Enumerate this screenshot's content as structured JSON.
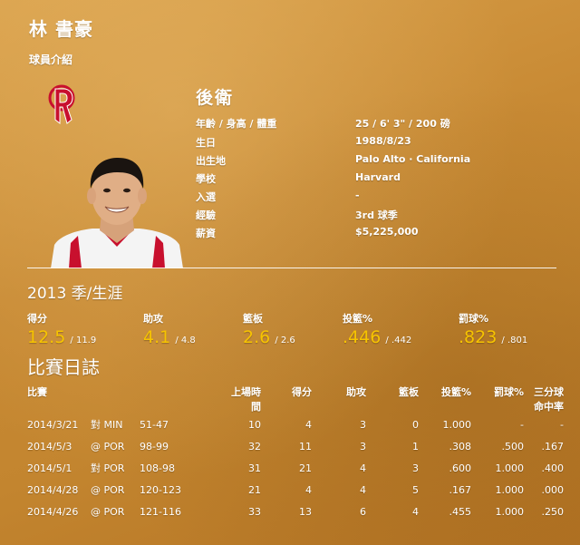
{
  "player": {
    "name": "林 書豪",
    "section_label": "球員介紹",
    "position": "後衛",
    "info": [
      {
        "label": "年齡 / 身高 / 體重",
        "value": "25 / 6' 3\" / 200 磅"
      },
      {
        "label": "生日",
        "value": "1988/8/23"
      },
      {
        "label": "出生地",
        "value": "Palo Alto · California"
      },
      {
        "label": "學校",
        "value": "Harvard"
      },
      {
        "label": "入選",
        "value": "-"
      },
      {
        "label": "經驗",
        "value": "3rd 球季"
      },
      {
        "label": "薪資",
        "value": "$5,225,000"
      }
    ]
  },
  "season": {
    "title": "2013 季/生涯",
    "stats": [
      {
        "label": "得分",
        "season": "12.5",
        "career": "/ 11.9"
      },
      {
        "label": "助攻",
        "season": "4.1",
        "career": "/ 4.8"
      },
      {
        "label": "籃板",
        "season": "2.6",
        "career": "/ 2.6"
      },
      {
        "label": "投籃%",
        "season": ".446",
        "career": "/ .442"
      },
      {
        "label": "罰球%",
        "season": ".823",
        "career": "/ .801"
      }
    ]
  },
  "game_log": {
    "title": "比賽日誌",
    "headers": {
      "game": "比賽",
      "minutes_line1": "上場時",
      "minutes_line2": "間",
      "points": "得分",
      "assists": "助攻",
      "rebounds": "籃板",
      "fg": "投籃%",
      "ft": "罰球%",
      "three_line1": "三分球",
      "three_line2": "命中率"
    },
    "rows": [
      {
        "date": "2014/3/21",
        "opp": "對 MIN",
        "score": "51-47",
        "min": "10",
        "pts": "4",
        "ast": "3",
        "reb": "0",
        "fg": "1.000",
        "ft": "-",
        "three": "-"
      },
      {
        "date": "2014/5/3",
        "opp": "@ POR",
        "score": "98-99",
        "min": "32",
        "pts": "11",
        "ast": "3",
        "reb": "1",
        "fg": ".308",
        "ft": ".500",
        "three": ".167"
      },
      {
        "date": "2014/5/1",
        "opp": "對 POR",
        "score": "108-98",
        "min": "31",
        "pts": "21",
        "ast": "4",
        "reb": "3",
        "fg": ".600",
        "ft": "1.000",
        "three": ".400"
      },
      {
        "date": "2014/4/28",
        "opp": "@ POR",
        "score": "120-123",
        "min": "21",
        "pts": "4",
        "ast": "4",
        "reb": "5",
        "fg": ".167",
        "ft": "1.000",
        "three": ".000"
      },
      {
        "date": "2014/4/26",
        "opp": "@ POR",
        "score": "121-116",
        "min": "33",
        "pts": "13",
        "ast": "6",
        "reb": "4",
        "fg": ".455",
        "ft": "1.000",
        "three": ".250"
      }
    ]
  },
  "colors": {
    "accent_yellow": "#f7c400",
    "rockets_red": "#c8102e"
  },
  "icons": {
    "team_logo": "rockets-logo"
  }
}
